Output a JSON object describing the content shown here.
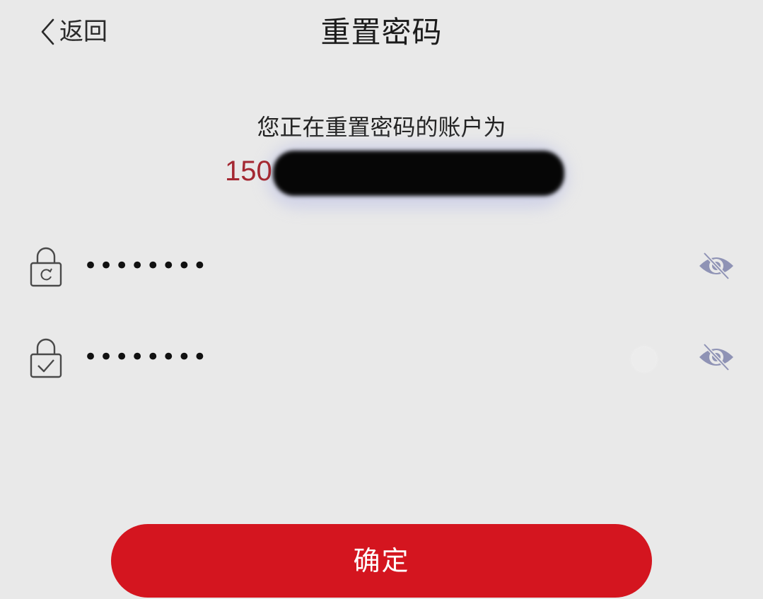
{
  "nav": {
    "back_label": "返回",
    "title": "重置密码"
  },
  "account_info": {
    "label": "您正在重置密码的账户为",
    "account_prefix": "150"
  },
  "fields": {
    "new_password": {
      "value": "••••••••",
      "icon": "lock-refresh-icon",
      "toggle_icon": "eye-slash-icon"
    },
    "confirm_password": {
      "value": "••••••••",
      "icon": "lock-check-icon",
      "toggle_icon": "eye-slash-icon",
      "clear_icon": "clear-icon"
    }
  },
  "confirm_button": {
    "label": "确定"
  },
  "colors": {
    "background": "#e9e9e9",
    "accent": "#d4151f",
    "account_prefix": "#a42832",
    "eye_icon": "#8f93b5"
  }
}
